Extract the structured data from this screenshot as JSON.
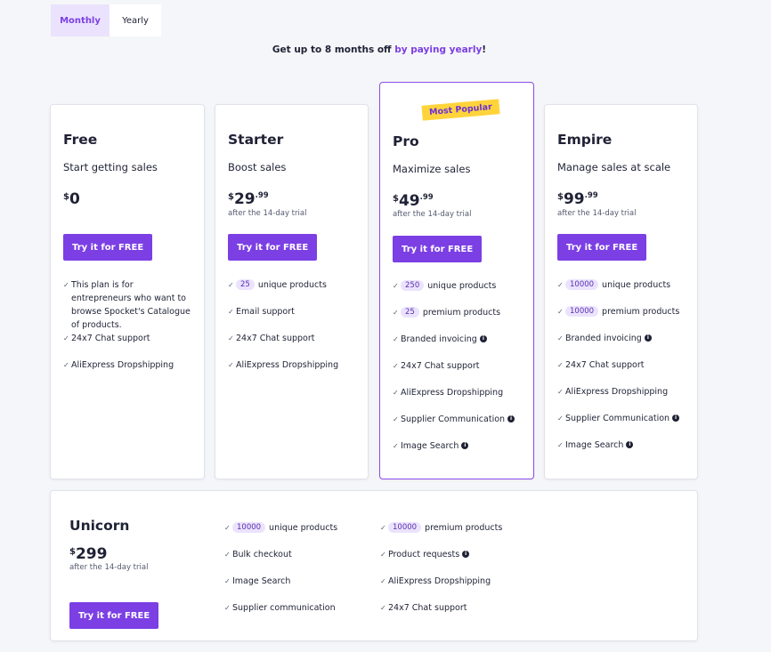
{
  "billing_toggle": {
    "monthly": "Monthly",
    "yearly": "Yearly"
  },
  "promo": {
    "prefix": "Get up to 8 months off ",
    "accent": "by paying yearly",
    "suffix": "!"
  },
  "plans": [
    {
      "name": "Free",
      "tagline": "Start getting sales",
      "currency": "$",
      "amount": "0",
      "cents": "",
      "trial": "",
      "cta": "Try it for FREE",
      "features": [
        {
          "count": "",
          "text": "This plan is for entrepreneurs who want to browse Spocket's Catalogue of products.",
          "info": false
        },
        {
          "count": "",
          "text": "24x7 Chat support",
          "info": false
        },
        {
          "count": "",
          "text": "AliExpress Dropshipping",
          "info": false
        }
      ]
    },
    {
      "name": "Starter",
      "tagline": "Boost sales",
      "currency": "$",
      "amount": "29",
      "cents": ".99",
      "trial": "after the 14-day trial",
      "cta": "Try it for FREE",
      "features": [
        {
          "count": "25",
          "text": "unique products",
          "info": false
        },
        {
          "count": "",
          "text": "Email support",
          "info": false
        },
        {
          "count": "",
          "text": "24x7 Chat support",
          "info": false
        },
        {
          "count": "",
          "text": "AliExpress Dropshipping",
          "info": false
        }
      ]
    },
    {
      "name": "Pro",
      "badge": "Most Popular",
      "tagline": "Maximize sales",
      "currency": "$",
      "amount": "49",
      "cents": ".99",
      "trial": "after the 14-day trial",
      "cta": "Try it for FREE",
      "features": [
        {
          "count": "250",
          "text": "unique products",
          "info": false
        },
        {
          "count": "25",
          "text": "premium products",
          "info": false
        },
        {
          "count": "",
          "text": "Branded invoicing",
          "info": true
        },
        {
          "count": "",
          "text": "24x7 Chat support",
          "info": false
        },
        {
          "count": "",
          "text": "AliExpress Dropshipping",
          "info": false
        },
        {
          "count": "",
          "text": "Supplier Communication",
          "info": true
        },
        {
          "count": "",
          "text": "Image Search",
          "info": true
        }
      ]
    },
    {
      "name": "Empire",
      "tagline": "Manage sales at scale",
      "currency": "$",
      "amount": "99",
      "cents": ".99",
      "trial": "after the 14-day trial",
      "cta": "Try it for FREE",
      "features": [
        {
          "count": "10000",
          "text": "unique products",
          "info": false
        },
        {
          "count": "10000",
          "text": "premium products",
          "info": false
        },
        {
          "count": "",
          "text": "Branded invoicing",
          "info": true
        },
        {
          "count": "",
          "text": "24x7 Chat support",
          "info": false
        },
        {
          "count": "",
          "text": "AliExpress Dropshipping",
          "info": false
        },
        {
          "count": "",
          "text": "Supplier Communication",
          "info": true
        },
        {
          "count": "",
          "text": "Image Search",
          "info": true
        }
      ]
    }
  ],
  "unicorn": {
    "name": "Unicorn",
    "currency": "$",
    "amount": "299",
    "trial": "after the 14-day trial",
    "cta": "Try it for FREE",
    "features_col1": [
      {
        "count": "10000",
        "text": "unique products",
        "info": false
      },
      {
        "count": "",
        "text": "Bulk checkout",
        "info": false
      },
      {
        "count": "",
        "text": "Image Search",
        "info": false
      },
      {
        "count": "",
        "text": "Supplier communication",
        "info": false
      }
    ],
    "features_col2": [
      {
        "count": "10000",
        "text": "premium products",
        "info": false
      },
      {
        "count": "",
        "text": "Product requests",
        "info": true
      },
      {
        "count": "",
        "text": "AliExpress Dropshipping",
        "info": false
      },
      {
        "count": "",
        "text": "24x7 Chat support",
        "info": false
      }
    ]
  },
  "icons": {
    "check": "check-icon",
    "info": "info-icon"
  },
  "colors": {
    "accent": "#7b3fe4",
    "accent_soft": "#ebe3fd",
    "badge": "#ffd43b",
    "text": "#1f2235",
    "background": "#f5f6f9"
  }
}
